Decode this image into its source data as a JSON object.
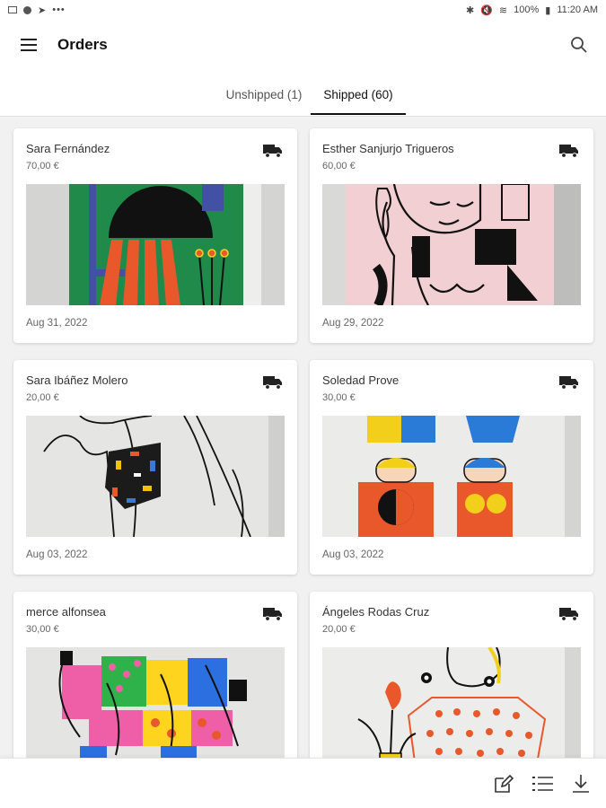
{
  "status_bar": {
    "time": "11:20 AM",
    "battery": "100%"
  },
  "header": {
    "title": "Orders"
  },
  "tabs": [
    {
      "label": "Unshipped (1)",
      "active": false
    },
    {
      "label": "Shipped (60)",
      "active": true
    }
  ],
  "orders": [
    {
      "customer": "Sara Fernández",
      "price": "70,00 €",
      "date": "Aug 31, 2022"
    },
    {
      "customer": "Esther Sanjurjo Trigueros",
      "price": "60,00 €",
      "date": "Aug 29, 2022"
    },
    {
      "customer": "Sara Ibáñez Molero",
      "price": "20,00 €",
      "date": "Aug 03, 2022"
    },
    {
      "customer": "Soledad Prove",
      "price": "30,00 €",
      "date": "Aug 03, 2022"
    },
    {
      "customer": "merce alfonsea",
      "price": "30,00 €",
      "date": ""
    },
    {
      "customer": "Ángeles Rodas Cruz",
      "price": "20,00 €",
      "date": ""
    }
  ],
  "icons": {
    "menu": "hamburger-icon",
    "search": "search-icon",
    "shipped": "truck-icon",
    "edit": "edit-icon",
    "list": "list-icon",
    "download": "download-icon"
  }
}
